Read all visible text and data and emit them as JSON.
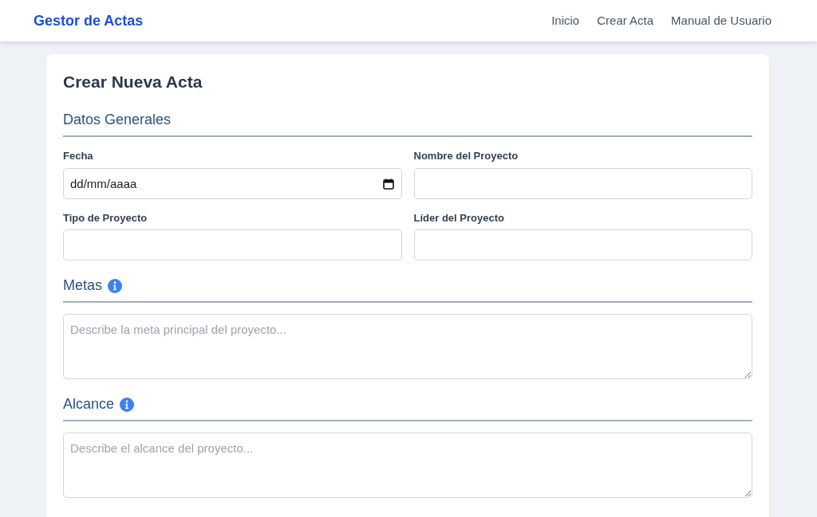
{
  "navbar": {
    "brand": "Gestor de Actas",
    "links": [
      "Inicio",
      "Crear Acta",
      "Manual de Usuario"
    ]
  },
  "form": {
    "title": "Crear Nueva Acta",
    "sections": [
      {
        "title": "Datos Generales",
        "info": false,
        "kind": "grid",
        "fields": [
          {
            "label": "Fecha",
            "kind": "date",
            "placeholder": "dd/mm/aaaa"
          },
          {
            "label": "Nombre del Proyecto",
            "kind": "text"
          },
          {
            "label": "Tipo de Proyecto",
            "kind": "text"
          },
          {
            "label": "Líder del Proyecto",
            "kind": "text"
          }
        ]
      },
      {
        "title": "Metas",
        "info": true,
        "kind": "textarea",
        "placeholder": "Describe la meta principal del proyecto..."
      },
      {
        "title": "Alcance",
        "info": true,
        "kind": "textarea",
        "placeholder": "Describe el alcance del proyecto..."
      }
    ]
  }
}
